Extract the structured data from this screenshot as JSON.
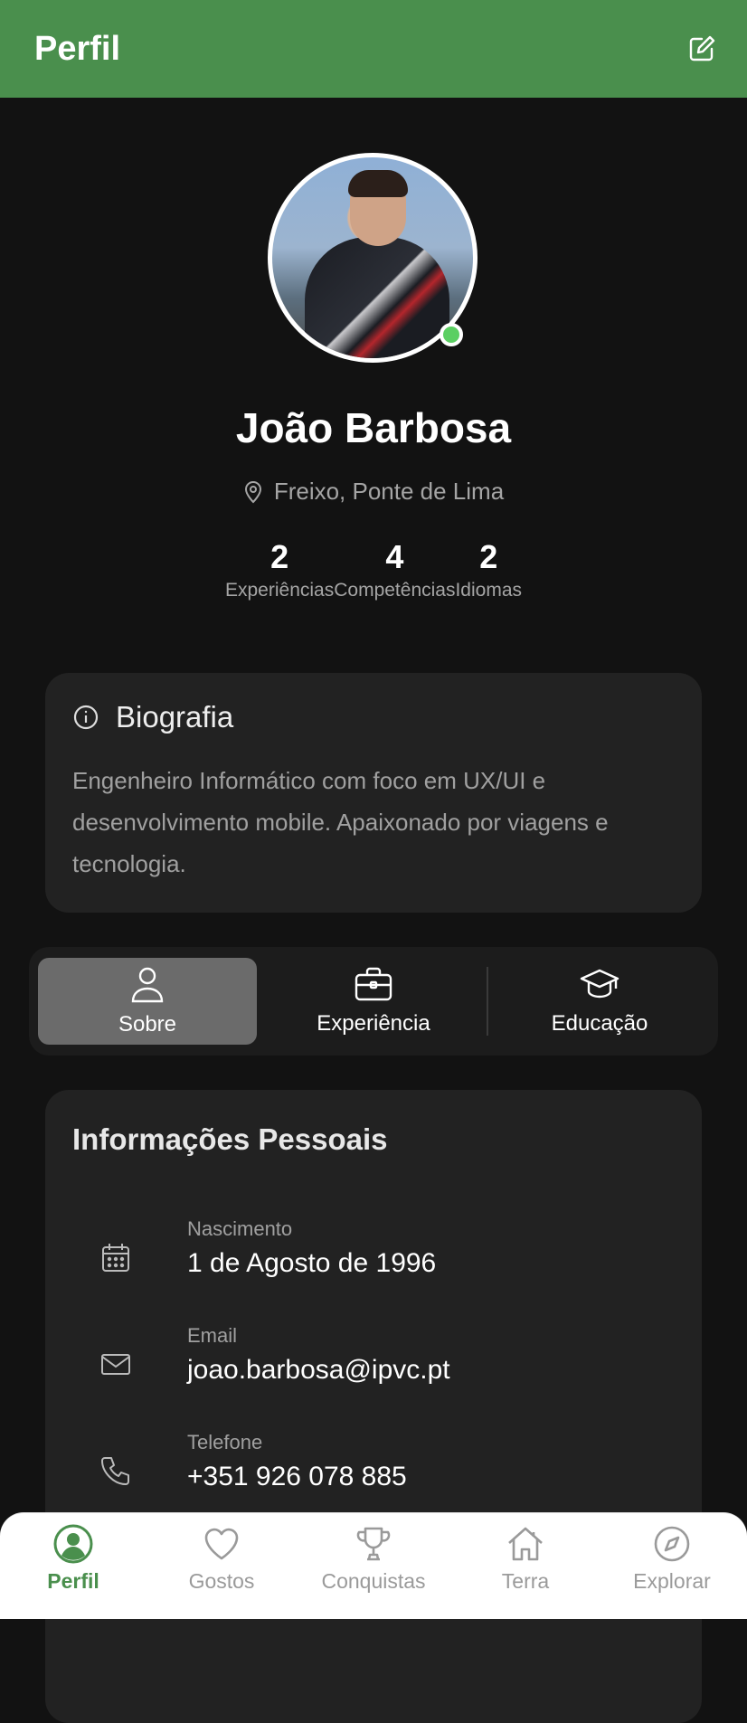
{
  "header": {
    "title": "Perfil"
  },
  "profile": {
    "name": "João Barbosa",
    "location": "Freixo, Ponte de Lima",
    "online": true
  },
  "stats": [
    {
      "value": "2",
      "label": "Experiências"
    },
    {
      "value": "4",
      "label": "Competências"
    },
    {
      "value": "2",
      "label": "Idiomas"
    }
  ],
  "bio": {
    "title": "Biografia",
    "text": "Engenheiro Informático com foco em UX/UI e desenvolvimento mobile. Apaixonado por viagens e tecnologia."
  },
  "tabs": [
    {
      "label": "Sobre",
      "icon": "person-icon",
      "active": true
    },
    {
      "label": "Experiência",
      "icon": "briefcase-icon",
      "active": false
    },
    {
      "label": "Educação",
      "icon": "graduation-cap-icon",
      "active": false
    }
  ],
  "personal_info": {
    "title": "Informações Pessoais",
    "rows": [
      {
        "label": "Nascimento",
        "value": "1 de Agosto de 1996",
        "icon": "calendar-icon"
      },
      {
        "label": "Email",
        "value": "joao.barbosa@ipvc.pt",
        "icon": "mail-icon"
      },
      {
        "label": "Telefone",
        "value": "+351 926 078 885",
        "icon": "phone-icon"
      }
    ]
  },
  "bottom_nav": [
    {
      "label": "Perfil",
      "icon": "user-circle-icon",
      "active": true
    },
    {
      "label": "Gostos",
      "icon": "heart-icon",
      "active": false
    },
    {
      "label": "Conquistas",
      "icon": "trophy-icon",
      "active": false
    },
    {
      "label": "Terra",
      "icon": "home-icon",
      "active": false
    },
    {
      "label": "Explorar",
      "icon": "compass-icon",
      "active": false
    }
  ],
  "colors": {
    "accent": "#4a8f4d",
    "background": "#121212",
    "card": "#222222",
    "online": "#5bcf62"
  }
}
